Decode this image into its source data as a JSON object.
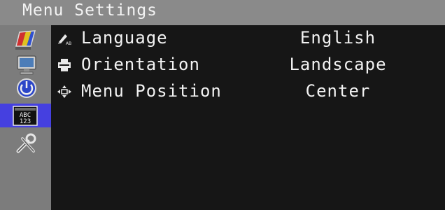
{
  "title": "Menu Settings",
  "sidebar": {
    "items": [
      {
        "icon": "color-adjust-icon"
      },
      {
        "icon": "screen-adjust-icon"
      },
      {
        "icon": "power-settings-icon"
      },
      {
        "icon": "menu-settings-icon",
        "label": "ABC 123",
        "selected": true
      },
      {
        "icon": "tools-icon"
      }
    ],
    "selected_color": "#4540e0"
  },
  "menu": {
    "items": [
      {
        "label": "Language",
        "value": "English",
        "icon": "language-icon"
      },
      {
        "label": "Orientation",
        "value": "Landscape",
        "icon": "orientation-icon"
      },
      {
        "label": "Menu Position",
        "value": "Center",
        "icon": "menu-position-icon"
      }
    ]
  }
}
